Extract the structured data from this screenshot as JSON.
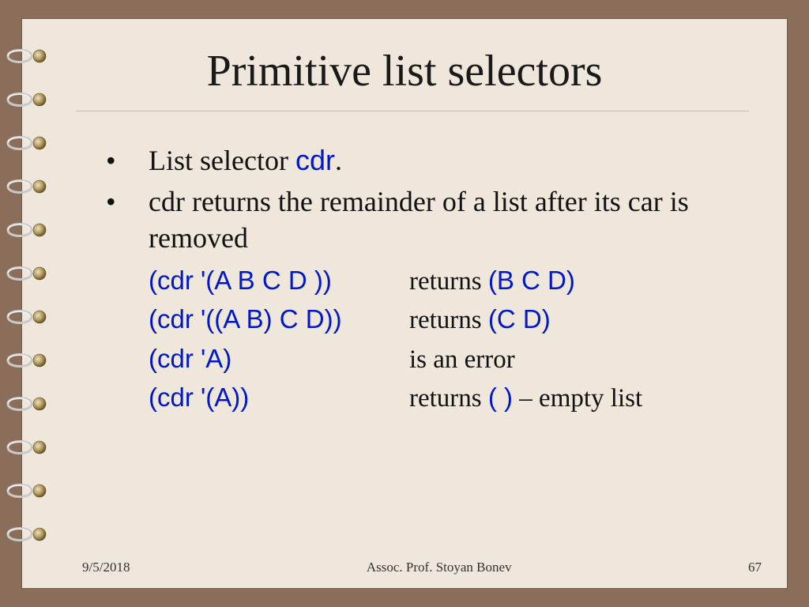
{
  "title": "Primitive list selectors",
  "bullets": [
    {
      "prefix": "List selector ",
      "kw": "cdr",
      "suffix": "."
    },
    {
      "text": "cdr returns the remainder of a list after its car is removed"
    }
  ],
  "examples": [
    {
      "lhs": "(cdr '(A B C D ))",
      "rhs_pre": "returns ",
      "rhs_kw": "(B C D)",
      "rhs_post": ""
    },
    {
      "lhs": "(cdr '((A B) C D))",
      "rhs_pre": "returns ",
      "rhs_kw": "(C D)",
      "rhs_post": ""
    },
    {
      "lhs": "(cdr 'A)",
      "rhs_pre": "is an error",
      "rhs_kw": "",
      "rhs_post": ""
    },
    {
      "lhs": "(cdr '(A))",
      "rhs_pre": "returns ",
      "rhs_kw": "( )",
      "rhs_post": " – empty list"
    }
  ],
  "footer": {
    "date": "9/5/2018",
    "author": "Assoc. Prof. Stoyan Bonev",
    "page": "67"
  }
}
